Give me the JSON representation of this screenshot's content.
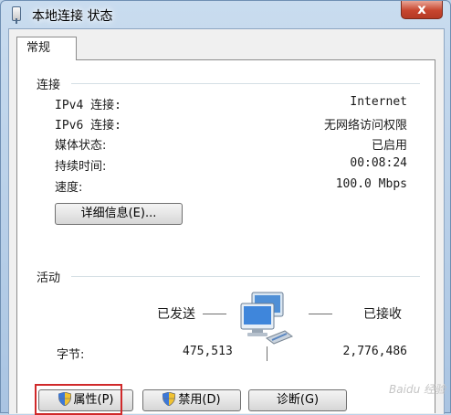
{
  "window": {
    "title": "本地连接 状态",
    "close_label": "x"
  },
  "tab": {
    "label": "常规"
  },
  "connection": {
    "group_title": "连接",
    "rows": [
      {
        "label": "IPv4 连接:",
        "value": "Internet"
      },
      {
        "label": "IPv6 连接:",
        "value": "无网络访问权限"
      },
      {
        "label": "媒体状态:",
        "value": "已启用"
      },
      {
        "label": "持续时间:",
        "value": "00:08:24"
      },
      {
        "label": "速度:",
        "value": "100.0 Mbps"
      }
    ],
    "details_button": "详细信息(E)..."
  },
  "activity": {
    "group_title": "活动",
    "sent_label": "已发送",
    "received_label": "已接收",
    "bytes_label": "字节:",
    "bytes_sent": "475,513",
    "bytes_received": "2,776,486"
  },
  "buttons": {
    "properties": "属性(P)",
    "disable": "禁用(D)",
    "diagnose": "诊断(G)"
  },
  "watermark": "Baidu 经验"
}
